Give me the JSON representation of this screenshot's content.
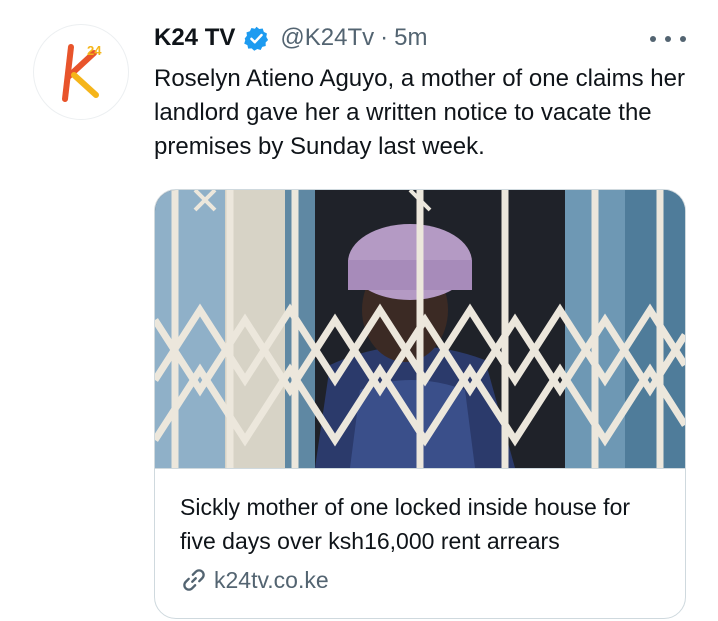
{
  "tweet": {
    "author": {
      "display_name": "K24 TV",
      "handle": "@K24Tv",
      "verified": true,
      "avatar_logo_text": "24"
    },
    "separator": "·",
    "timestamp": "5m",
    "text": "Roselyn Atieno Aguyo, a mother of one claims her landlord gave her a written notice to vacate the premises by Sunday last week.",
    "card": {
      "image_alt": "Woman in a knitted purple hat behind a white metal security grille",
      "title": "Sickly mother of one locked inside house for five days over ksh16,000 rent arrears",
      "domain": "k24tv.co.ke"
    }
  },
  "icons": {
    "verified": "verified-badge-icon",
    "more": "more-dots-icon",
    "link": "link-icon"
  },
  "colors": {
    "text_primary": "#0f1419",
    "text_secondary": "#536471",
    "verified_blue": "#1d9bf0",
    "border": "#cfd9de",
    "logo_orange": "#e8542b",
    "logo_yellow": "#f5b51a"
  }
}
